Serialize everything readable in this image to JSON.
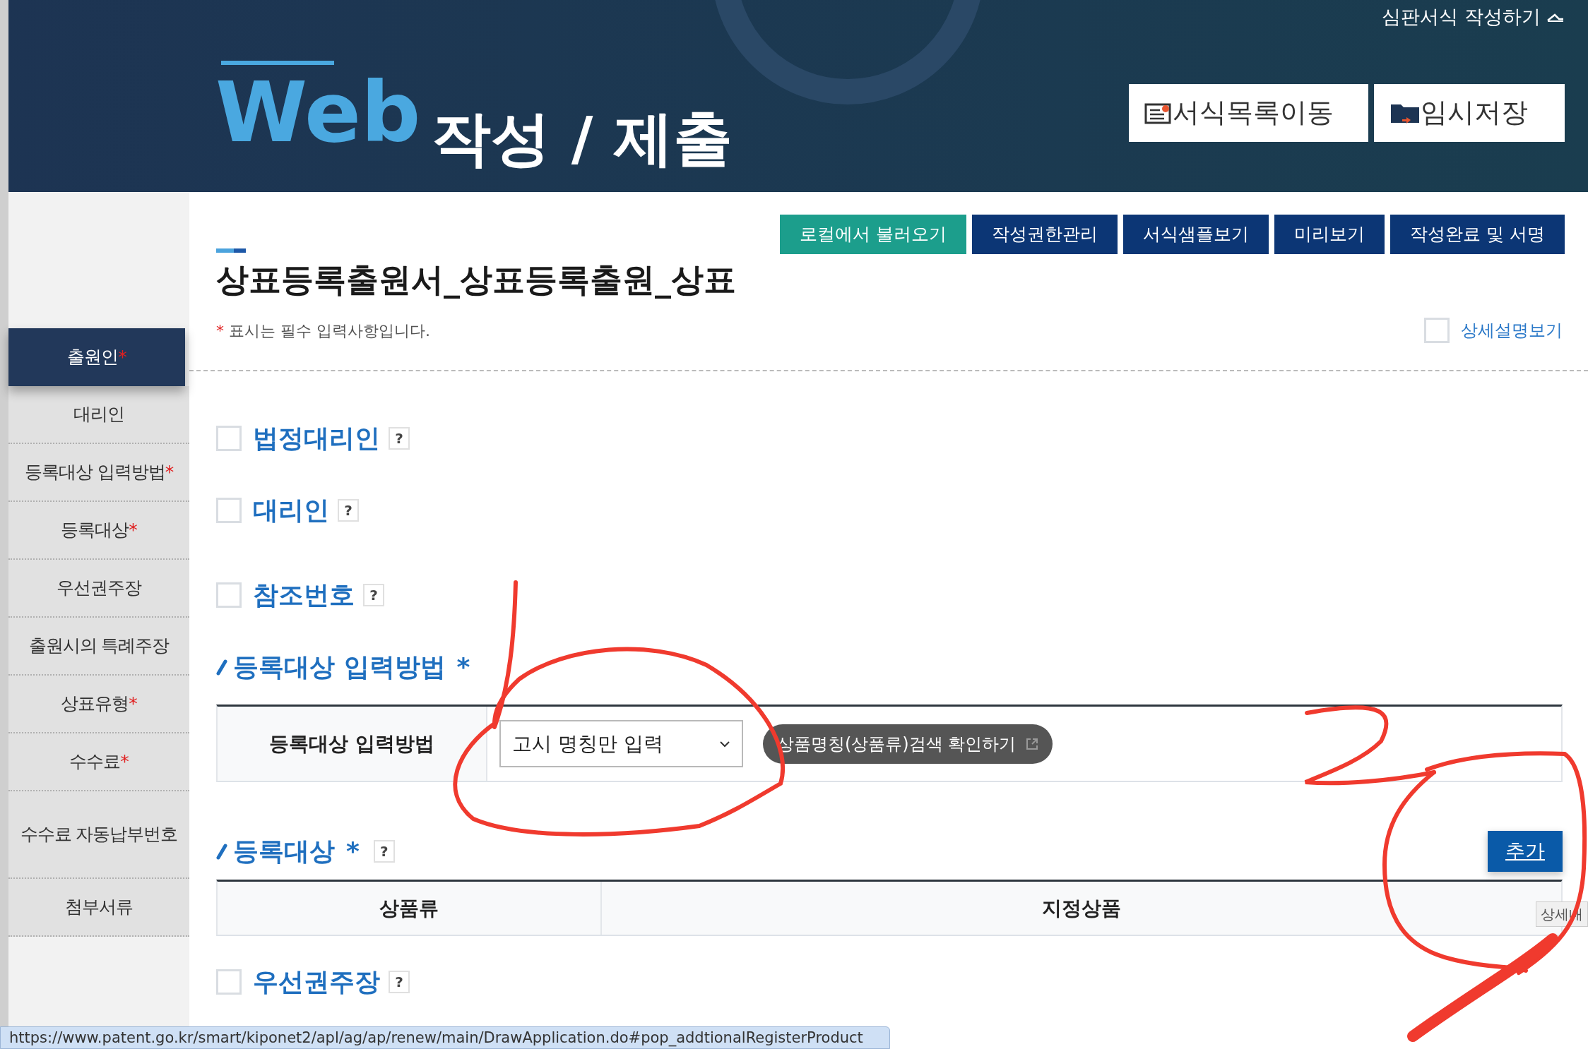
{
  "header": {
    "logo": "Web",
    "title": "작성 / 제출",
    "top_link": "심판서식 작성하기",
    "buttons": [
      {
        "label": "서식목록이동",
        "kind": "list"
      },
      {
        "label": "임시저장",
        "kind": "save"
      }
    ]
  },
  "toolbar": [
    {
      "label": "로컬에서 불러오기",
      "kind": "teal"
    },
    {
      "label": "작성권한관리",
      "kind": "navy"
    },
    {
      "label": "서식샘플보기",
      "kind": "navy"
    },
    {
      "label": "미리보기",
      "kind": "navy"
    },
    {
      "label": "작성완료 및 서명",
      "kind": "navy"
    }
  ],
  "sidebar": {
    "items": [
      {
        "label": "출원인",
        "mark": "*",
        "selected": true
      },
      {
        "label": "대리인",
        "selected": false
      },
      {
        "label": "등록대상 입력방법",
        "mark": "*",
        "selected": false
      },
      {
        "label": "등록대상",
        "mark": "*",
        "selected": false
      },
      {
        "label": "우선권주장",
        "selected": false
      },
      {
        "label": "출원시의 특례주장",
        "selected": false
      },
      {
        "label": "상표유형",
        "mark": "*",
        "selected": false
      },
      {
        "label": "수수료",
        "mark": "*",
        "selected": false
      },
      {
        "label": "수수료 자동납부번호",
        "selected": false
      },
      {
        "label": "첨부서류",
        "selected": false
      }
    ]
  },
  "page": {
    "title": "상표등록출원서_상표등록출원_상표",
    "note_mark": "*",
    "note": "표시는 필수 입력사항입니다.",
    "detail_toggle": {
      "label": "상세설명보기",
      "checked": false
    }
  },
  "sections": [
    {
      "kind": "checkbox",
      "label": "법정대리인",
      "checked": false,
      "help": "?"
    },
    {
      "kind": "checkbox",
      "label": "대리인",
      "checked": false,
      "help": "?"
    },
    {
      "kind": "checkbox",
      "label": "참조번호",
      "checked": false,
      "help": "?"
    },
    {
      "kind": "method",
      "label": "등록대상 입력방법",
      "mark": "*",
      "row_label": "등록대상 입력방법",
      "select_value": "고시 명칭만 입력",
      "search_button": "상품명칭(상품류)검색 확인하기"
    },
    {
      "kind": "target",
      "label": "등록대상",
      "mark": "*",
      "help": "?",
      "add_button": "추가",
      "columns": [
        "상품류",
        "지정상품"
      ]
    },
    {
      "kind": "checkbox",
      "label": "우선권주장",
      "checked": false,
      "help": "?"
    }
  ],
  "tooltip": "상세내",
  "status_bar": "https://www.patent.go.kr/smart/kiponet2/apl/ag/ap/renew/main/DrawApplication.do#pop_addtionalRegisterProduct"
}
